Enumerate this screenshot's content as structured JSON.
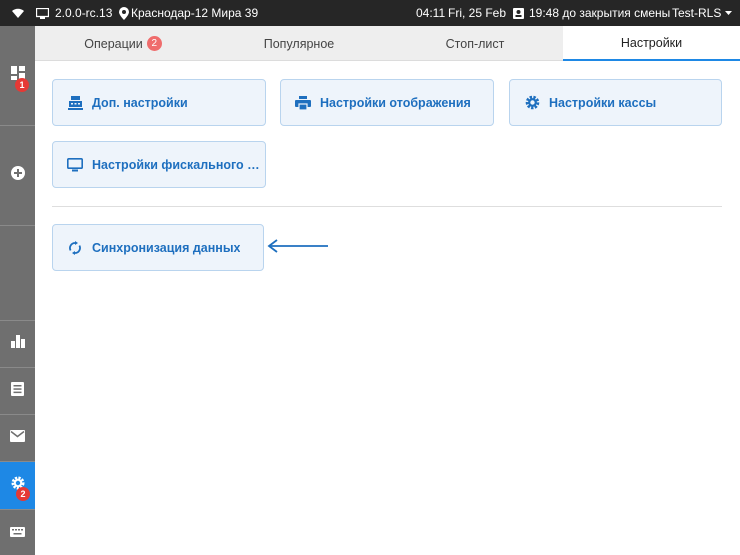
{
  "statusbar": {
    "version": "2.0.0-rc.13",
    "location": "Краснодар-12 Мира 39",
    "time": "04:11",
    "date": "Fri, 25 Feb",
    "shift": "19:48 до закрытия смены",
    "user": "Test-RLS"
  },
  "sidebar": {
    "dashboard_badge": "1",
    "settings_badge": "2"
  },
  "tabs": [
    {
      "label": "Операции",
      "badge": "2"
    },
    {
      "label": "Популярное"
    },
    {
      "label": "Стоп-лист"
    },
    {
      "label": "Настройки"
    }
  ],
  "cards": {
    "extra_settings": "Доп. настройки",
    "display_settings": "Настройки отображения",
    "register_settings": "Настройки кассы",
    "fiscal_settings": "Настройки фискального пр...",
    "data_sync": "Синхронизация данных"
  },
  "colors": {
    "accent": "#1e88e5",
    "card_bg": "#eef4fb",
    "badge": "#e53935",
    "sidebar": "#6f6f6f",
    "statusbar": "#262626"
  }
}
